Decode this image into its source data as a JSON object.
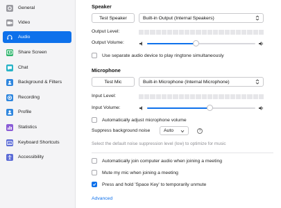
{
  "sidebar": {
    "items": [
      {
        "label": "General",
        "icon": "gear-icon",
        "color": "#9a9aa0"
      },
      {
        "label": "Video",
        "icon": "video-camera-icon",
        "color": "#9a9aa0"
      },
      {
        "label": "Audio",
        "icon": "headphones-icon",
        "color": "#0e71eb",
        "active": true
      },
      {
        "label": "Share Screen",
        "icon": "share-screen-icon",
        "color": "#2cb46a"
      },
      {
        "label": "Chat",
        "icon": "chat-bubble-icon",
        "color": "#28b3c7"
      },
      {
        "label": "Background & Filters",
        "icon": "background-person-icon",
        "color": "#2e86de"
      },
      {
        "label": "Recording",
        "icon": "record-icon",
        "color": "#2e86de"
      },
      {
        "label": "Profile",
        "icon": "profile-icon",
        "color": "#2e86de"
      },
      {
        "label": "Statistics",
        "icon": "statistics-icon",
        "color": "#8a5cd6"
      },
      {
        "label": "Keyboard Shortcuts",
        "icon": "keyboard-icon",
        "color": "#5b6bd6"
      },
      {
        "label": "Accessibility",
        "icon": "accessibility-icon",
        "color": "#5b6bd6"
      }
    ]
  },
  "speaker": {
    "title": "Speaker",
    "test_label": "Test Speaker",
    "device": "Built-in Output (Internal Speakers)",
    "output_level_label": "Output Level:",
    "output_volume_label": "Output Volume:",
    "volume_fraction": 0.45
  },
  "separate_device": {
    "label": "Use separate audio device to play ringtone simultaneously",
    "checked": false
  },
  "microphone": {
    "title": "Microphone",
    "test_label": "Test Mic",
    "device": "Built-in Microphone (Internal Microphone)",
    "input_level_label": "Input Level:",
    "input_volume_label": "Input Volume:",
    "volume_fraction": 0.58
  },
  "auto_adjust": {
    "label": "Automatically adjust microphone volume",
    "checked": false
  },
  "suppress": {
    "label": "Suppress background noise",
    "value": "Auto",
    "help": "?",
    "hint": "Select the default noise suppression level (low) to optimize for music"
  },
  "options": [
    {
      "label": "Automatically join computer audio when joining a meeting",
      "checked": false
    },
    {
      "label": "Mute my mic when joining a meeting",
      "checked": false
    },
    {
      "label": "Press and hold 'Space Key' to temporarily unmute",
      "checked": true
    }
  ],
  "advanced_label": "Advanced",
  "accent_color": "#0e71eb"
}
